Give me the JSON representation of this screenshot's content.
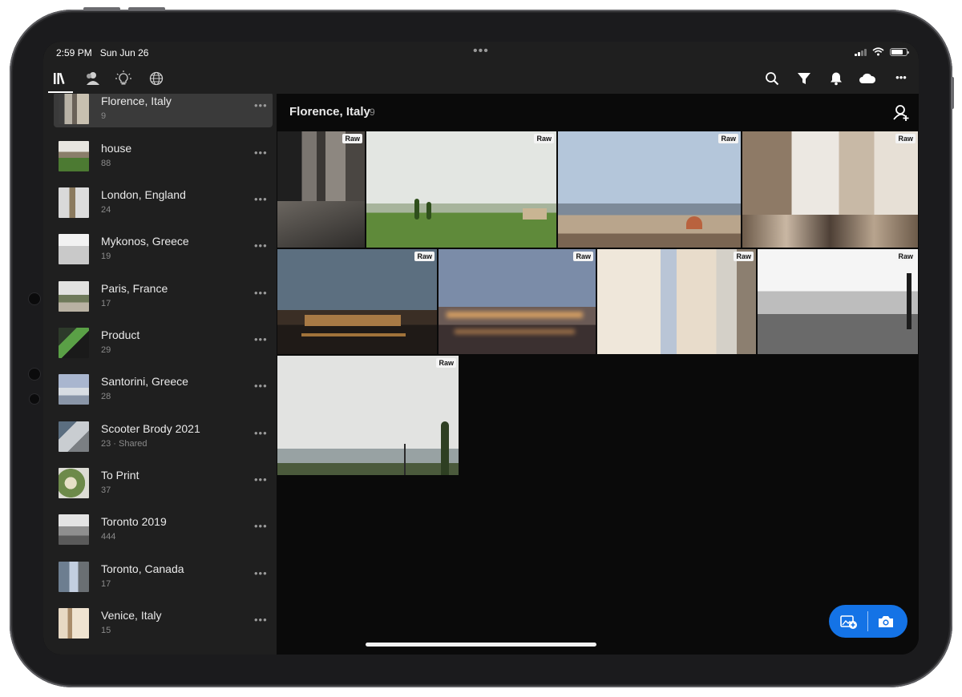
{
  "status_bar": {
    "time": "2:59 PM",
    "date": "Sun Jun 26",
    "dots": "•••"
  },
  "toolbar": {
    "left_icons": [
      "library-icon",
      "people-icon",
      "learn-bulb-icon",
      "discover-globe-icon"
    ],
    "right_icons": [
      "search-icon",
      "filter-icon",
      "bell-icon",
      "cloud-icon",
      "more-icon"
    ],
    "more_label": "•••"
  },
  "sidebar": {
    "more_label": "•••",
    "albums": [
      {
        "name": "Florence, Italy",
        "count": "9"
      },
      {
        "name": "house",
        "count": "88"
      },
      {
        "name": "London, England",
        "count": "24"
      },
      {
        "name": "Mykonos, Greece",
        "count": "19"
      },
      {
        "name": "Paris, France",
        "count": "17"
      },
      {
        "name": "Product",
        "count": "29"
      },
      {
        "name": "Santorini, Greece",
        "count": "28"
      },
      {
        "name": "Scooter Brody 2021",
        "count": "23 · Shared"
      },
      {
        "name": "To Print",
        "count": "37"
      },
      {
        "name": "Toronto 2019",
        "count": "444"
      },
      {
        "name": "Toronto, Canada",
        "count": "17"
      },
      {
        "name": "Venice, Italy",
        "count": "15"
      }
    ]
  },
  "main": {
    "title": "Florence, Italy",
    "count": "9",
    "raw_label": "Raw"
  },
  "colors": {
    "accent": "#1473e6",
    "sidebar_bg": "#1f1f1f",
    "grid_bg": "#0a0a0a"
  }
}
